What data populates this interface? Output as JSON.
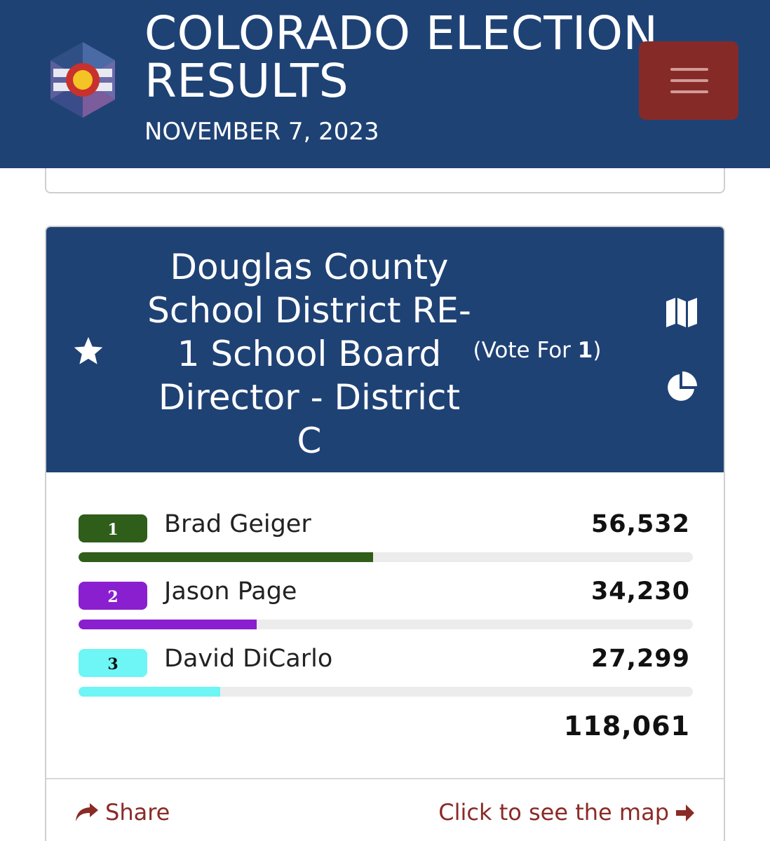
{
  "header": {
    "title": "COLORADO ELECTION RESULTS",
    "date": "NOVEMBER 7, 2023",
    "logo_icon": "colorado-flag-logo-icon",
    "menu_icon": "hamburger-menu-icon",
    "bg_color": "#1f4275",
    "menu_color": "#862a28"
  },
  "contest": {
    "title": "Douglas County School District RE-1 School Board Director - District C",
    "vote_for_prefix": "(Vote For ",
    "vote_for_count": "1",
    "vote_for_suffix": ")",
    "icons": [
      "star-icon",
      "map-icon",
      "pie-chart-icon"
    ],
    "candidates": [
      {
        "rank": "1",
        "name": "Brad Geiger",
        "votes": "56,532",
        "share": 0.479,
        "color": "#2e5e1a",
        "text_color": "#ffffff"
      },
      {
        "rank": "2",
        "name": "Jason Page",
        "votes": "34,230",
        "share": 0.29,
        "color": "#8a1fd0",
        "text_color": "#ffffff"
      },
      {
        "rank": "3",
        "name": "David DiCarlo",
        "votes": "27,299",
        "share": 0.231,
        "color": "#6ef5f5",
        "text_color": "#111111"
      }
    ],
    "total_votes": "118,061",
    "footer": {
      "share_label": "Share",
      "map_label": "Click to see the map",
      "link_color": "#8a2b27"
    }
  }
}
